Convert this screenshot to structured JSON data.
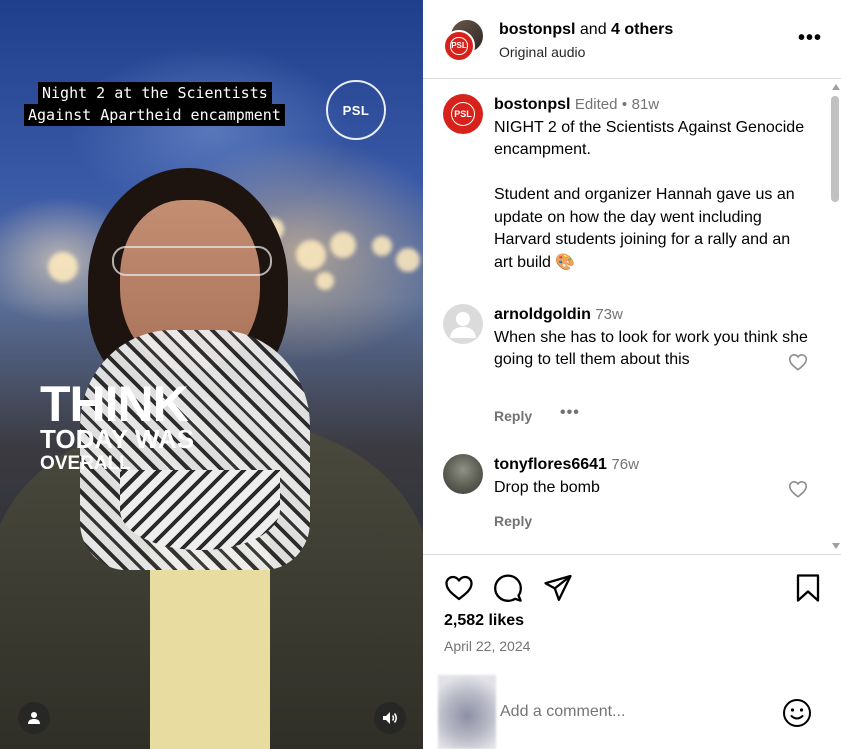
{
  "video": {
    "caption_line1": "Night 2 at the Scientists",
    "caption_line2": "Against Apartheid encampment",
    "badge_text": "PSL",
    "overlay_big": "THINK",
    "overlay_mid": "TODAY WAS",
    "overlay_small": "OVERALL",
    "user_button_icon": "person-icon",
    "sound_button_icon": "speaker-icon"
  },
  "header": {
    "username": "bostonpsl",
    "and_text": "and",
    "others": "4 others",
    "subtitle": "Original audio",
    "more_label": "•••"
  },
  "caption_comment": {
    "username": "bostonpsl",
    "edited": "Edited",
    "separator": "•",
    "time": "81w",
    "text": "NIGHT 2 of the Scientists Against Genocide encampment.\n\nStudent and organizer Hannah gave us an update on how the day went including Harvard students joining for a rally and an art build 🎨"
  },
  "comments": [
    {
      "username": "arnoldgoldin",
      "time": "73w",
      "text": "When she has to look for work you think she going to tell them about this",
      "reply_label": "Reply",
      "more_label": "•••"
    },
    {
      "username": "tonyflores6641",
      "time": "76w",
      "text": "Drop the bomb",
      "reply_label": "Reply"
    }
  ],
  "post": {
    "likes": "2,582 likes",
    "date": "April 22, 2024"
  },
  "add_comment": {
    "placeholder": "Add a comment..."
  },
  "colors": {
    "brand_red": "#d6221b",
    "muted": "#737373",
    "divider": "#dbdbdb"
  }
}
